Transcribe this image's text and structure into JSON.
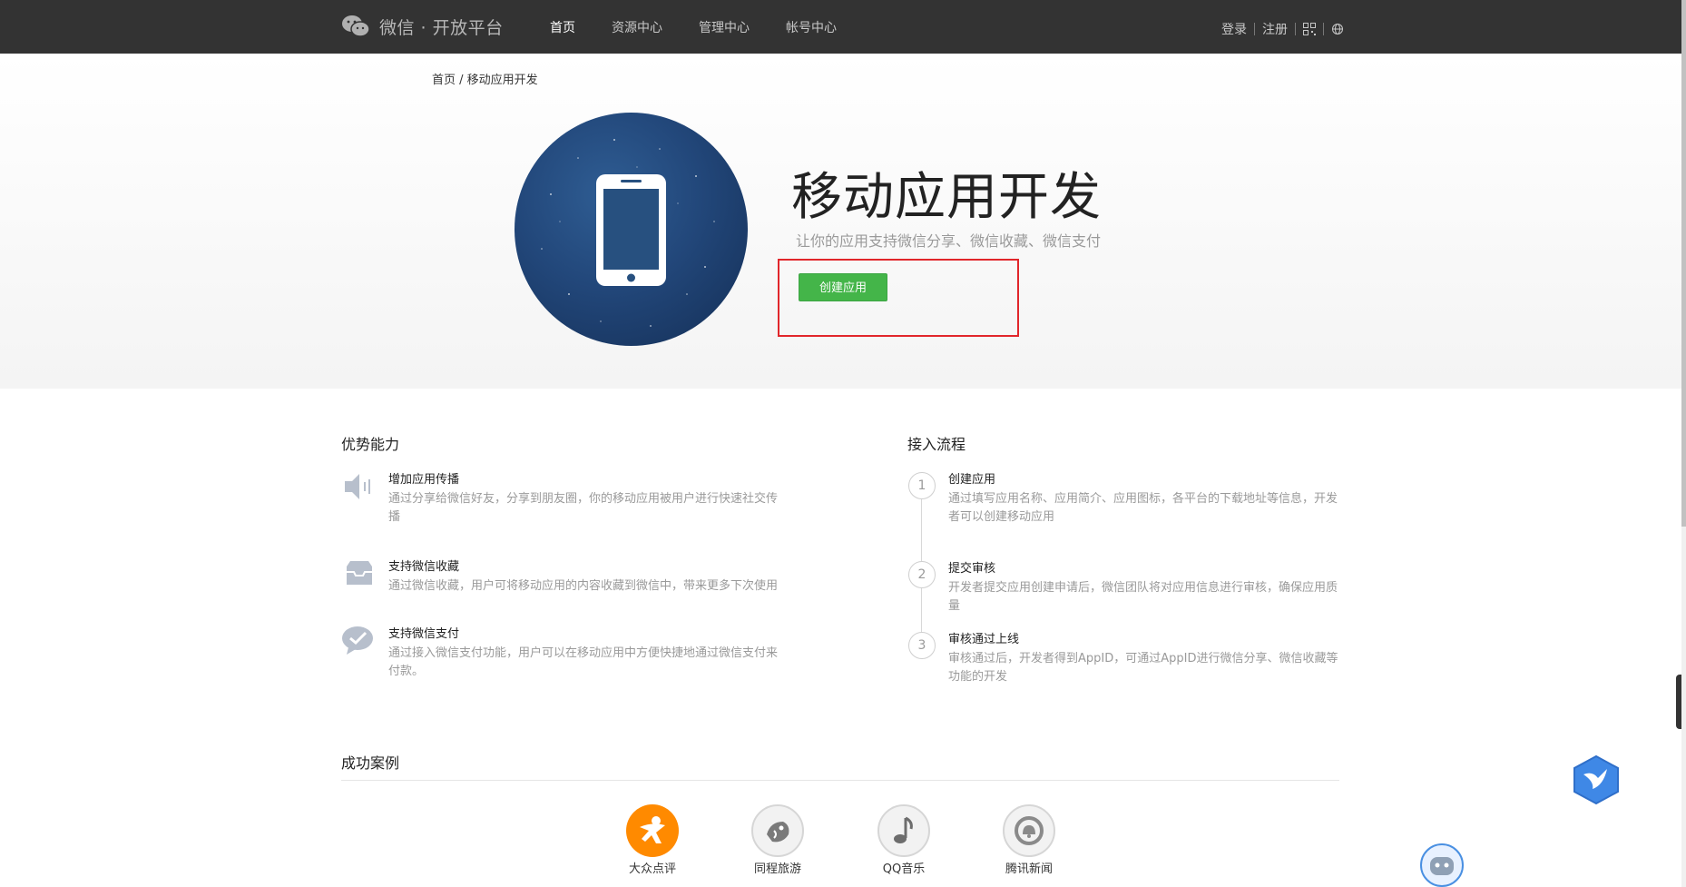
{
  "header": {
    "logo_text": "微信 · 开放平台",
    "nav": [
      {
        "label": "首页",
        "active": true
      },
      {
        "label": "资源中心",
        "active": false
      },
      {
        "label": "管理中心",
        "active": false
      },
      {
        "label": "帐号中心",
        "active": false
      }
    ],
    "login": "登录",
    "register": "注册"
  },
  "breadcrumb": "首页 / 移动应用开发",
  "hero": {
    "title": "移动应用开发",
    "subtitle": "让你的应用支持微信分享、微信收藏、微信支付",
    "create_button": "创建应用"
  },
  "advantages": {
    "title": "优势能力",
    "items": [
      {
        "title": "增加应用传播",
        "desc": "通过分享给微信好友，分享到朋友圈，你的移动应用被用户进行快速社交传播",
        "icon": "speaker-icon"
      },
      {
        "title": "支持微信收藏",
        "desc": "通过微信收藏，用户可将移动应用的内容收藏到微信中，带来更多下次使用",
        "icon": "inbox-icon"
      },
      {
        "title": "支持微信支付",
        "desc": "通过接入微信支付功能，用户可以在移动应用中方便快捷地通过微信支付来付款。",
        "icon": "pay-check-icon"
      }
    ]
  },
  "process": {
    "title": "接入流程",
    "steps": [
      {
        "num": "1",
        "title": "创建应用",
        "desc": "通过填写应用名称、应用简介、应用图标，各平台的下载地址等信息，开发者可以创建移动应用"
      },
      {
        "num": "2",
        "title": "提交审核",
        "desc": "开发者提交应用创建申请后，微信团队将对应用信息进行审核，确保应用质量"
      },
      {
        "num": "3",
        "title": "审核通过上线",
        "desc": "审核通过后，开发者得到AppID，可通过AppID进行微信分享、微信收藏等功能的开发"
      }
    ]
  },
  "cases": {
    "title": "成功案例",
    "items": [
      {
        "label": "大众点评",
        "color": "#ff8a00"
      },
      {
        "label": "同程旅游",
        "color": "#f2f2f2"
      },
      {
        "label": "QQ音乐",
        "color": "#f2f2f2"
      },
      {
        "label": "腾讯新闻",
        "color": "#f2f2f2"
      }
    ]
  },
  "colors": {
    "topbar": "#333333",
    "accent_green": "#44b549",
    "highlight_red": "#e1262b"
  }
}
